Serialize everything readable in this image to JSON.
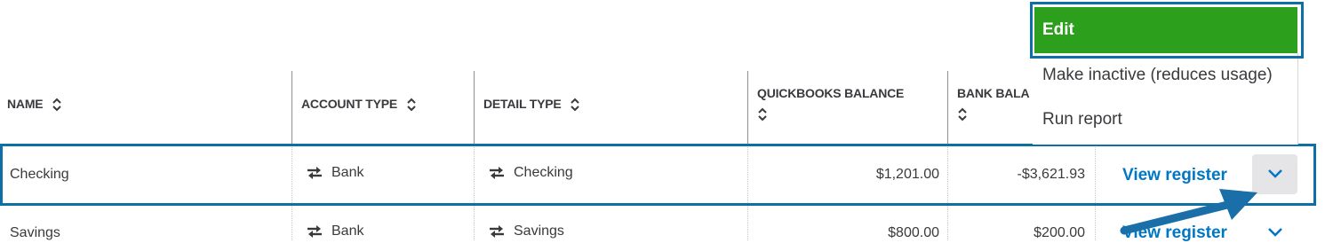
{
  "table": {
    "headers": {
      "name": "NAME",
      "account_type": "ACCOUNT TYPE",
      "detail_type": "DETAIL TYPE",
      "qb_balance": "QUICKBOOKS BALANCE",
      "bank_balance": "BANK BALA"
    },
    "rows": [
      {
        "name": "Checking",
        "account_type": "Bank",
        "detail_type": "Checking",
        "qb_balance": "$1,201.00",
        "bank_balance": "-$3,621.93",
        "action": "View register"
      },
      {
        "name": "Savings",
        "account_type": "Bank",
        "detail_type": "Savings",
        "qb_balance": "$800.00",
        "bank_balance": "$200.00",
        "action": "View register"
      }
    ]
  },
  "menu": {
    "edit": "Edit",
    "make_inactive": "Make inactive (reduces usage)",
    "run_report": "Run report"
  },
  "icons": {
    "sort": "sort-icon",
    "transfer": "transfer-icon",
    "chevron": "chevron-down-icon",
    "arrow": "callout-arrow"
  },
  "colors": {
    "accent_green": "#2ca01c",
    "link_blue": "#0077c5",
    "highlight_blue": "#0e6ea6"
  }
}
